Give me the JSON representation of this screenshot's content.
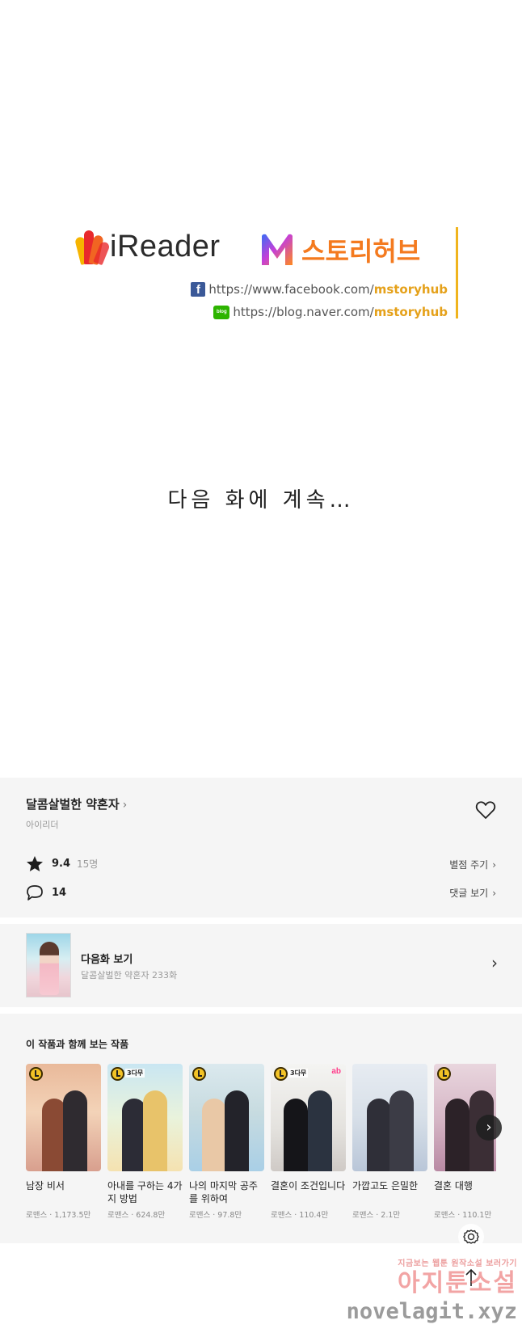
{
  "publisher": {
    "ireader_logo": "iReader",
    "mstory_logo_left": "M",
    "mstory_logo_right": "스토리허브",
    "facebook_link_prefix": "https://www.facebook.com/",
    "facebook_link_id": "mstoryhub",
    "blog_link_prefix": "https://blog.naver.com/",
    "blog_link_id": "mstoryhub",
    "blog_icon_text": "blog",
    "facebook_icon_text": "f"
  },
  "continue_text": "다음 화에 계속…",
  "series": {
    "title": "달콤살벌한 약혼자",
    "title_chevron": "›",
    "author": "아이리더",
    "rating": "9.4",
    "rating_count": "15명",
    "rate_label": "별점 주기",
    "comment_count": "14",
    "comments_label": "댓글 보기",
    "chevron": "›"
  },
  "next_episode": {
    "label": "다음화 보기",
    "subtitle": "달콤살벌한 약혼자 233화",
    "chevron": "›"
  },
  "recommendations": {
    "heading": "이 작품과 함께 보는 작품",
    "next_button": "›",
    "items": [
      {
        "title": "남장 비서",
        "meta": "로맨스 · 1,173.5만",
        "badge": ""
      },
      {
        "title": "아내를 구하는 4가지 방법",
        "meta": "로맨스 · 624.8만",
        "badge": "3다무"
      },
      {
        "title": "나의 마지막 공주를 위하여",
        "meta": "로맨스 · 97.8만",
        "badge": ""
      },
      {
        "title": "결혼이 조건입니다",
        "meta": "로맨스 · 110.4만",
        "badge": "3다무"
      },
      {
        "title": "가깝고도 은밀한",
        "meta": "로맨스 · 2.1만",
        "badge": ""
      },
      {
        "title": "결혼 대행",
        "meta": "로맨스 · 110.1만",
        "badge": ""
      }
    ]
  },
  "watermark": {
    "top_line": "지금보는 웹툰 원작소설 보러가기",
    "main": "아지툰소설",
    "url": "novelagit.xyz"
  },
  "colors": {
    "accent_orange": "#f47a1f",
    "accent_gold": "#e5a11a",
    "panel_bg": "#f5f5f5"
  },
  "icons": [
    "star-icon",
    "comment-icon",
    "heart-icon",
    "settings-icon",
    "scroll-top-icon",
    "clock-icon"
  ]
}
